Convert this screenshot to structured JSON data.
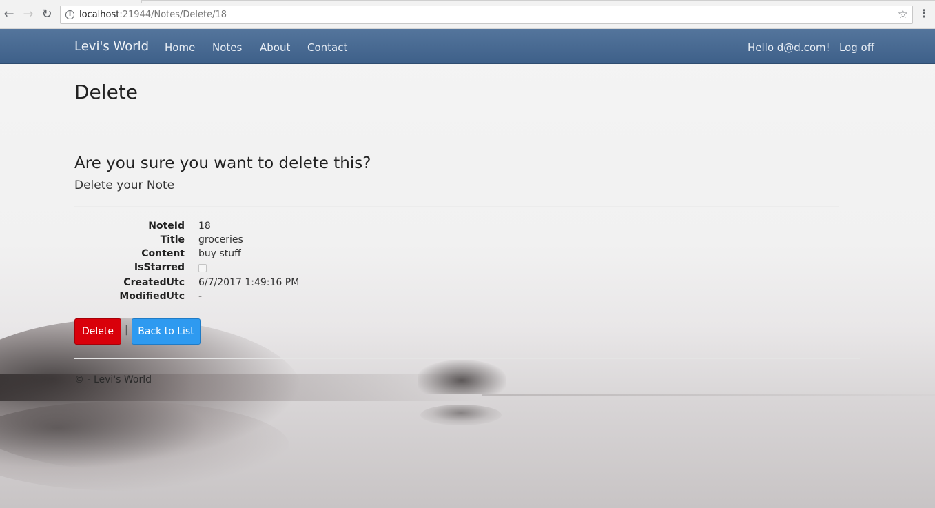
{
  "browser": {
    "url_host": "localhost",
    "url_path": ":21944/Notes/Delete/18",
    "back_icon": "arrow-left-icon",
    "forward_icon": "arrow-right-icon",
    "reload_icon": "reload-icon",
    "info_icon": "info-icon",
    "bookmark_icon": "star-icon",
    "menu_icon": "more-vert-icon"
  },
  "navbar": {
    "brand": "Levi's World",
    "links": [
      "Home",
      "Notes",
      "About",
      "Contact"
    ],
    "hello": "Hello d@d.com!",
    "logoff": "Log off",
    "color": "#4a6b93"
  },
  "page": {
    "title": "Delete",
    "confirm": "Are you sure you want to delete this?",
    "subheading": "Delete your Note"
  },
  "details": [
    {
      "label": "NoteId",
      "value": "18"
    },
    {
      "label": "Title",
      "value": "groceries"
    },
    {
      "label": "Content",
      "value": "buy stuff"
    },
    {
      "label": "IsStarred",
      "value": ""
    },
    {
      "label": "CreatedUtc",
      "value": "6/7/2017 1:49:16 PM"
    },
    {
      "label": "ModifiedUtc",
      "value": "-"
    }
  ],
  "is_starred": false,
  "actions": {
    "delete_label": "Delete",
    "separator": "|",
    "back_label": "Back to List",
    "delete_color": "#d9000a",
    "back_color": "#2e9af0"
  },
  "footer": {
    "text": "© - Levi's World"
  }
}
